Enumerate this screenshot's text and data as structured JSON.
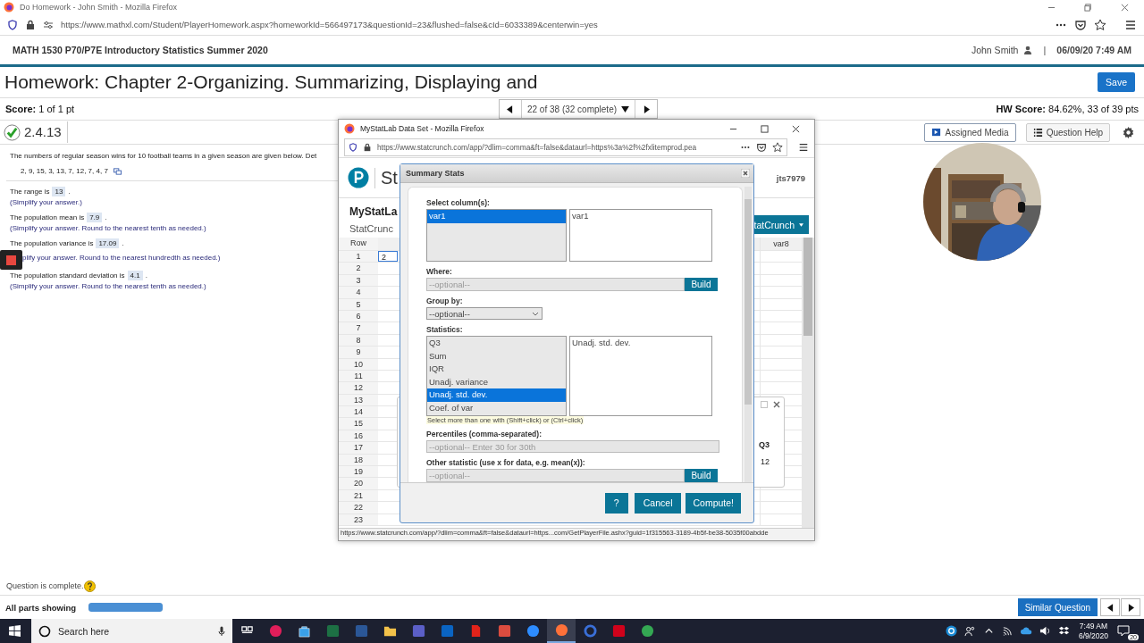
{
  "browser": {
    "title": "Do Homework - John Smith - Mozilla Firefox",
    "url": "https://www.mathxl.com/Student/PlayerHomework.aspx?homeworkId=566497173&questionId=23&flushed=false&cId=6033389&centerwin=yes"
  },
  "header": {
    "course": "MATH 1530 P70/P7E Introductory Statistics Summer 2020",
    "user": "John Smith",
    "separator": "|",
    "datetime": "06/09/20 7:49 AM"
  },
  "homework": {
    "title": "Homework: Chapter 2-Organizing. Summarizing, Displaying and",
    "save_button": "Save",
    "score": "**Score:** 1 of 1 pt",
    "navigator": "22 of 38 (32 complete)",
    "hw_score": "**HW Score:** 84.62%, 33 of 39 pts"
  },
  "question": {
    "number": "2.4.13",
    "complete": true,
    "tools": [
      "Assigned Media",
      "Question Help"
    ],
    "prompt": "The numbers of regular season wins for 10 football teams in a given season are given below. Det",
    "data": "2, 9, 15, 3, 13, 7, 12, 7, 4, 7",
    "parts": [
      {
        "text": "The range is",
        "answer": "13",
        "end": ".",
        "hint": "(Simplify your answer.)",
        "recording_control": false
      },
      {
        "text": "The population mean is",
        "answer": "7.9",
        "end": ".",
        "hint": "(Simplify your answer. Round to the nearest tenth as needed.)",
        "recording_control": false
      },
      {
        "text": "The population variance is",
        "answer": "17.09",
        "end": ".",
        "hint": "plify your answer. Round to the nearest hundredth as needed.)",
        "recording_control": true
      },
      {
        "text": "The population standard deviation is",
        "answer": "4.1",
        "end": ".",
        "hint": "(Simplify your answer. Round to the nearest tenth as needed.)",
        "recording_control": false
      }
    ]
  },
  "footer": {
    "status": "Question is complete.",
    "parts_label": "All parts showing",
    "level": 1,
    "similar_button": "Similar Question"
  },
  "popup": {
    "title": "MyStatLab Data Set - Mozilla Firefox",
    "url": "https://www.statcrunch.com/app/?dlim=comma&ft=false&dataurl=https%3a%2f%2fxlitemprod.pea",
    "logo_text": "St",
    "username": "jts7979",
    "heading": "MyStatLa",
    "subheading": "StatCrunc",
    "menu_button": "tatCrunch",
    "grid": {
      "row_header": "Row",
      "column_header": "var8",
      "cell": "2",
      "rows": [
        "1",
        "2",
        "3",
        "4",
        "5",
        "6",
        "7",
        "8",
        "9",
        "10",
        "11",
        "12",
        "13",
        "14",
        "15",
        "16",
        "17",
        "18",
        "19",
        "20",
        "21",
        "22",
        "23"
      ]
    },
    "back_dialog": {
      "header": "Q3",
      "value": "12"
    },
    "status_url": "https://www.statcrunch.com/app/?dlim=comma&ft=false&dataurl=https...com/GetPlayerFile.ashx?guid=1f315563-3189-4b5f-be38-5035f00abdde"
  },
  "dialog": {
    "title": "Summary Stats",
    "select_label": "Select column(s):",
    "columns": [
      {
        "name": "var1",
        "selected": true
      }
    ],
    "chosen_columns": [
      "var1"
    ],
    "where_label": "Where:",
    "where_placeholder": "--optional--",
    "build_button": "Build",
    "group_label": "Group by:",
    "group_value": "--optional--",
    "statistics_label": "Statistics:",
    "statistics": [
      {
        "name": "Q3",
        "selected": false
      },
      {
        "name": "Sum",
        "selected": false
      },
      {
        "name": "IQR",
        "selected": false
      },
      {
        "name": "Unadj. variance",
        "selected": false
      },
      {
        "name": "Unadj. std. dev.",
        "selected": true
      },
      {
        "name": "Coef. of var",
        "selected": false
      }
    ],
    "chosen_statistics": [
      "Unadj. std. dev."
    ],
    "tip": "Select more than one with (Shift+click) or (Ctrl+click)",
    "percentiles_label": "Percentiles (comma-separated):",
    "percentiles_placeholder": "--optional-- Enter 30 for 30th",
    "other_label": "Other statistic (use x for data, e.g. mean(x)):",
    "other_placeholder": "--optional--",
    "other_build_button": "Build",
    "buttons": [
      {
        "label": "?",
        "kind": "help"
      },
      {
        "label": "Cancel",
        "kind": "cancel"
      },
      {
        "label": "Compute!",
        "kind": "compute"
      }
    ]
  },
  "taskbar": {
    "search_placeholder": "Search here",
    "time": "7:49 AM",
    "date": "6/9/2020",
    "notifications": "20"
  }
}
